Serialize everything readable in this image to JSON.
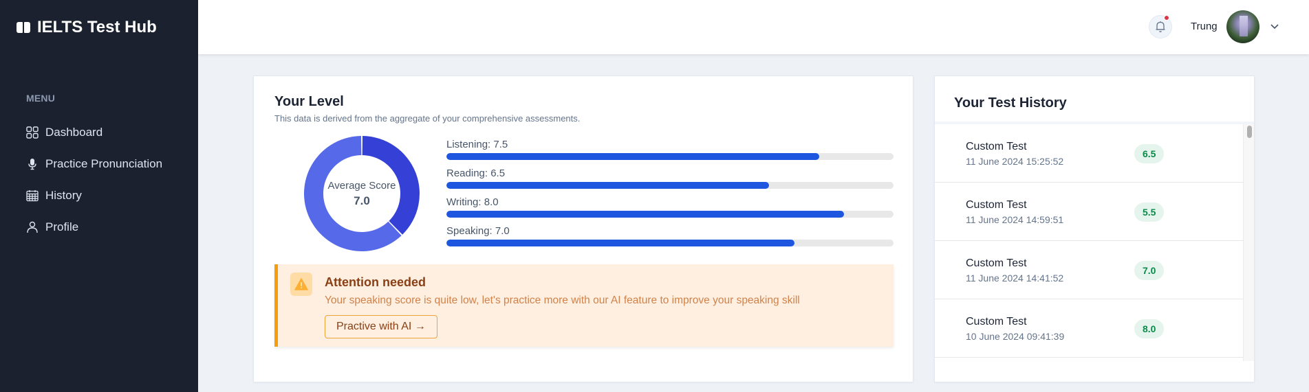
{
  "app": {
    "title": "IELTS Test Hub",
    "icon": "book-open-icon"
  },
  "sidebar": {
    "menu_label": "MENU",
    "items": [
      {
        "label": "Dashboard",
        "icon": "grid-icon"
      },
      {
        "label": "Practice Pronunciation",
        "icon": "microphone-icon"
      },
      {
        "label": "History",
        "icon": "calendar-icon"
      },
      {
        "label": "Profile",
        "icon": "user-icon"
      }
    ]
  },
  "header": {
    "username": "Trung",
    "notification_icon": "bell-icon",
    "has_unread_notification": true,
    "dropdown_icon": "chevron-down-icon"
  },
  "level": {
    "title": "Your Level",
    "description": "This data is derived from the aggregate of your comprehensive assessments.",
    "average_label": "Average Score",
    "average_value": "7.0",
    "max_score": 9,
    "donut_colors": {
      "score": "#3541d6",
      "remainder": "#5669e8"
    },
    "skills": [
      {
        "label": "Listening: 7.5",
        "score": 7.5
      },
      {
        "label": "Reading: 6.5",
        "score": 6.5
      },
      {
        "label": "Writing: 8.0",
        "score": 8.0
      },
      {
        "label": "Speaking: 7.0",
        "score": 7.0
      }
    ],
    "bar_color": "#1e56e0"
  },
  "alert": {
    "icon": "warning-icon",
    "title": "Attention needed",
    "message": "Your speaking score is quite low, let's practice more with our AI feature to improve your speaking skill",
    "button_label": "Practive with AI →"
  },
  "history": {
    "title": "Your Test History",
    "items": [
      {
        "name": "Custom Test",
        "date": "11 June 2024 15:25:52",
        "score": "6.5"
      },
      {
        "name": "Custom Test",
        "date": "11 June 2024 14:59:51",
        "score": "5.5"
      },
      {
        "name": "Custom Test",
        "date": "11 June 2024 14:41:52",
        "score": "7.0"
      },
      {
        "name": "Custom Test",
        "date": "10 June 2024 09:41:39",
        "score": "8.0"
      }
    ]
  }
}
